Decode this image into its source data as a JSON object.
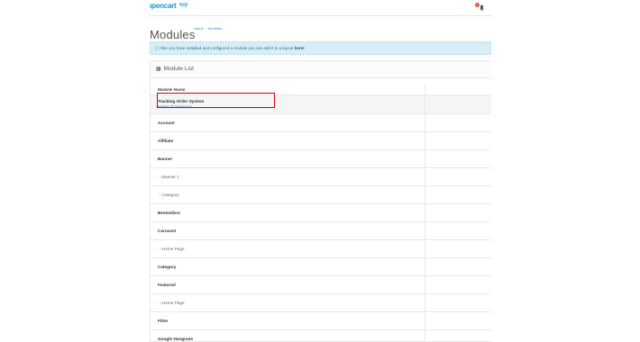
{
  "header": {
    "logo_text": "ıpencart",
    "notification_count": "1"
  },
  "page": {
    "title": "Modules",
    "breadcrumb": [
      "Home",
      "Modules"
    ]
  },
  "info_alert": {
    "text": "After you have installed and configured a module you can add it to a layout ",
    "link": "here!"
  },
  "panel": {
    "title": "Module List",
    "column_header": "Module Name",
    "highlighted_module": {
      "title": "Tracking Order System",
      "vendor_link": "Weba IT Solutions"
    },
    "rows": [
      {
        "label": "Account",
        "level": "parent"
      },
      {
        "label": "Affiliate",
        "level": "parent"
      },
      {
        "label": "Banner",
        "level": "parent"
      },
      {
        "label": "Banner 1",
        "level": "child"
      },
      {
        "label": "Category",
        "level": "child"
      },
      {
        "label": "Bestsellers",
        "level": "parent"
      },
      {
        "label": "Carousel",
        "level": "parent"
      },
      {
        "label": "Home Page",
        "level": "child"
      },
      {
        "label": "Category",
        "level": "parent"
      },
      {
        "label": "Featured",
        "level": "parent"
      },
      {
        "label": "Home Page",
        "level": "child"
      },
      {
        "label": "Filter",
        "level": "parent"
      },
      {
        "label": "Google Hangouts",
        "level": "parent"
      }
    ]
  },
  "colors": {
    "accent": "#1e91cf",
    "highlight_border": "#d00000",
    "alert_bg": "#d9edf7"
  }
}
